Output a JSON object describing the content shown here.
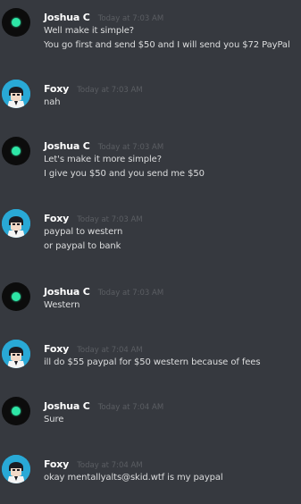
{
  "chat": {
    "messages": [
      {
        "author": "Joshua C",
        "avatar": "green-dot-avatar",
        "timestamp": "Today at 7:03 AM",
        "lines": [
          "Well make it simple?",
          "You go first and send $50 and I will send you $72 PayPal"
        ]
      },
      {
        "author": "Foxy",
        "avatar": "anime-character-avatar",
        "timestamp": "Today at 7:03 AM",
        "lines": [
          "nah"
        ]
      },
      {
        "author": "Joshua C",
        "avatar": "green-dot-avatar",
        "timestamp": "Today at 7:03 AM",
        "lines": [
          "Let's make it more simple?",
          "I give you $50 and you send me $50"
        ]
      },
      {
        "author": "Foxy",
        "avatar": "anime-character-avatar",
        "timestamp": "Today at 7:03 AM",
        "lines": [
          "paypal to western",
          "or paypal to bank"
        ]
      },
      {
        "author": "Joshua C",
        "avatar": "green-dot-avatar",
        "timestamp": "Today at 7:03 AM",
        "lines": [
          "Western"
        ]
      },
      {
        "author": "Foxy",
        "avatar": "anime-character-avatar",
        "timestamp": "Today at 7:04 AM",
        "lines": [
          "ill do $55 paypal for $50 western because of fees"
        ]
      },
      {
        "author": "Joshua C",
        "avatar": "green-dot-avatar",
        "timestamp": "Today at 7:04 AM",
        "lines": [
          "Sure"
        ]
      },
      {
        "author": "Foxy",
        "avatar": "anime-character-avatar",
        "timestamp": "Today at 7:04 AM",
        "lines": [
          "okay mentallyalts@skid.wtf is my paypal"
        ]
      }
    ]
  },
  "colors": {
    "background": "#36393f",
    "username": "#ffffff",
    "timestamp": "#5b5e63",
    "message_text": "#dcddde",
    "status_dot": "#2ee6a6",
    "foxy_avatar_bg": "#29a9d6"
  }
}
